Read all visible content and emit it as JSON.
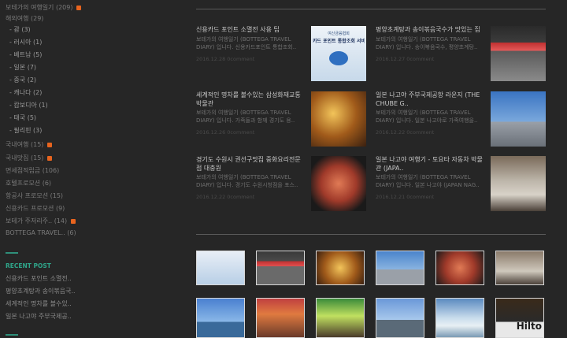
{
  "sidebar": {
    "categories": [
      {
        "label": "보테가의 여행일기 (209)",
        "rss": true
      },
      {
        "label": "해외여행 (29)",
        "rss": false
      },
      {
        "label": "- 괌 (3)",
        "rss": false
      },
      {
        "label": "- 러시아 (1)",
        "rss": false
      },
      {
        "label": "- 베트남 (5)",
        "rss": false
      },
      {
        "label": "- 일본 (7)",
        "rss": false
      },
      {
        "label": "- 중국 (2)",
        "rss": false
      },
      {
        "label": "- 캐나다 (2)",
        "rss": false
      },
      {
        "label": "- 캄보디아 (1)",
        "rss": false
      },
      {
        "label": "- 태국 (5)",
        "rss": false
      },
      {
        "label": "- 필리핀 (3)",
        "rss": false
      },
      {
        "label": "국내여행 (15)",
        "rss": true
      },
      {
        "label": "국내맛집 (15)",
        "rss": true
      },
      {
        "label": "면세점적립금 (106)",
        "rss": false
      },
      {
        "label": "호텔프로모션 (6)",
        "rss": false
      },
      {
        "label": "항공사 프로모션 (15)",
        "rss": false
      },
      {
        "label": "신용카드 프로모션 (9)",
        "rss": false
      },
      {
        "label": "보테가 주저리주.. (14)",
        "rss": true
      },
      {
        "label": "BOTTEGA TRAVEL.. (6)",
        "rss": false
      }
    ],
    "recent_title": "RECENT POST",
    "recent": [
      "신용카드 포인트 소멸전..",
      "평양초계탕과 송이볶음국..",
      "세계적인 명차를 볼수있..",
      "일본 나고야 주부국제공.."
    ]
  },
  "posts": [
    {
      "title": "신용카드 포인트 소멸전 사용 팁",
      "summary": "보테가의 여행일기 (BOTTEGA TRAVEL DIARY) 입니다. 신용카드포인트 통합조회..",
      "meta": "2016.12.28  0comment",
      "img_label": "카드 포인트 통합조회 서비스",
      "img_top": "여신금융협회"
    },
    {
      "title": "평양초계탕과 송이볶음국수가 맛있는 집",
      "summary": "보테가의 여행일기 (BOTTEGA TRAVEL DIARY) 입니다. 송이볶음국수, 평양초계탕..",
      "meta": "2016.12.27  0comment",
      "img_label": "",
      "img_top": ""
    },
    {
      "title": "세계적인 명차를 볼수있는 삼성화재교통박물관",
      "summary": "보테가의 여행일기 (BOTTEGA TRAVEL DIARY) 입니다. 가족들과 함께 경기도 용..",
      "meta": "2016.12.26  0comment",
      "img_label": "",
      "img_top": ""
    },
    {
      "title": "일본 나고야 주부국제공항 라운지 (THE CHUBE G..",
      "summary": "보테가의 여행일기 (BOTTEGA TRAVEL DIARY) 입니다. 일본 나고야로 가족여행을..",
      "meta": "2016.12.22  0comment",
      "img_label": "",
      "img_top": ""
    },
    {
      "title": "경기도 수원시 권선구맛집 중화요리전문점 대충원",
      "summary": "보테가의 여행일기 (BOTTEGA TRAVEL DIARY) 입니다. 경기도 수원시청점을 포스..",
      "meta": "2016.12.22  0comment",
      "img_label": "",
      "img_top": ""
    },
    {
      "title": "일본 나고야 여행기 - 토요타 자동차 박물관 (JAPA..",
      "summary": "보테가의 여행일기 (BOTTEGA TRAVEL DIARY) 입니다. 일본 나고야 (JAPAN NAG..",
      "meta": "2016.12.21  0comment",
      "img_label": "",
      "img_top": ""
    }
  ],
  "gallery_right_text": "Hilto",
  "colors": {
    "background": "#262626",
    "accent": "#2fa58a",
    "rss": "#e8641e"
  }
}
